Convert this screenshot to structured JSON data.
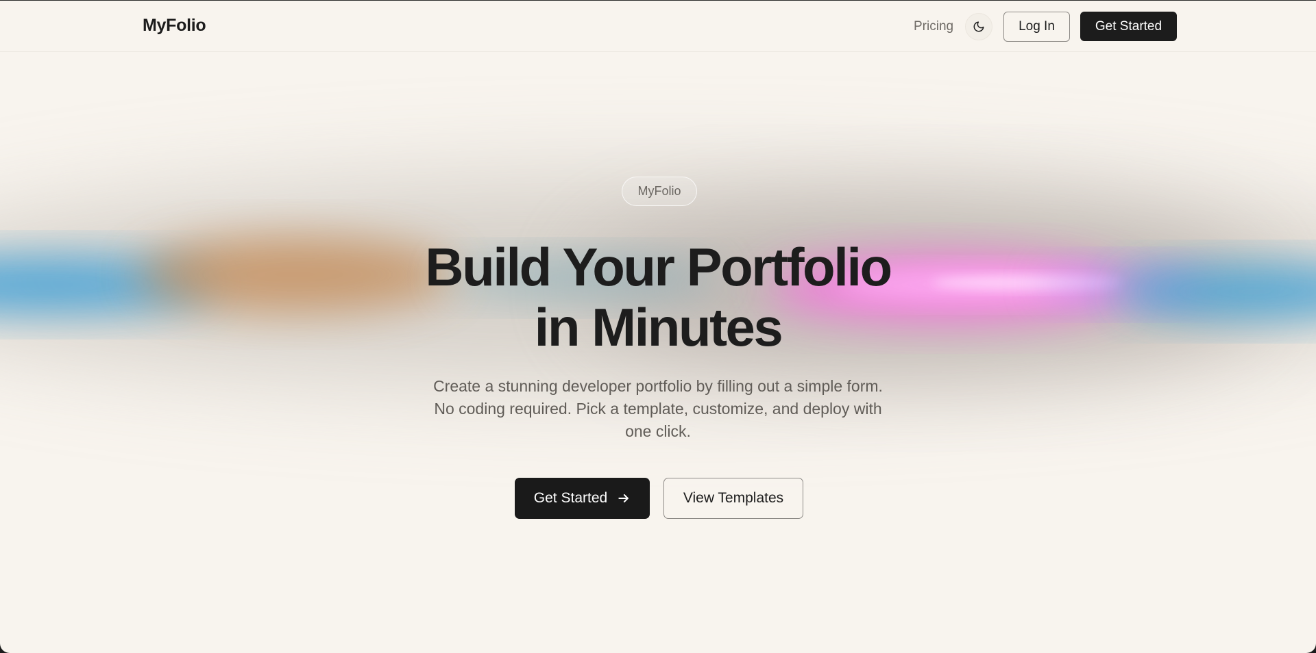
{
  "nav": {
    "brand": "MyFolio",
    "pricing_label": "Pricing",
    "theme_icon": "moon-icon",
    "login_label": "Log In",
    "get_started_label": "Get Started"
  },
  "hero": {
    "badge": "MyFolio",
    "headline_line1": "Build Your Portfolio",
    "headline_line2": "in Minutes",
    "subtitle_line1": "Create a stunning developer portfolio by filling out a simple form.",
    "subtitle_line2": "No coding required. Pick a template, customize, and deploy with",
    "subtitle_line3": "one click.",
    "primary_cta": "Get Started",
    "primary_cta_icon": "arrow-right-icon",
    "secondary_cta": "View Templates"
  },
  "colors": {
    "background": "#f8f4ee",
    "primary_button": "#1a1a1a",
    "band_blue": "#3a9fd6",
    "band_pink": "#ff8bf0",
    "band_orange": "#c48a55"
  }
}
